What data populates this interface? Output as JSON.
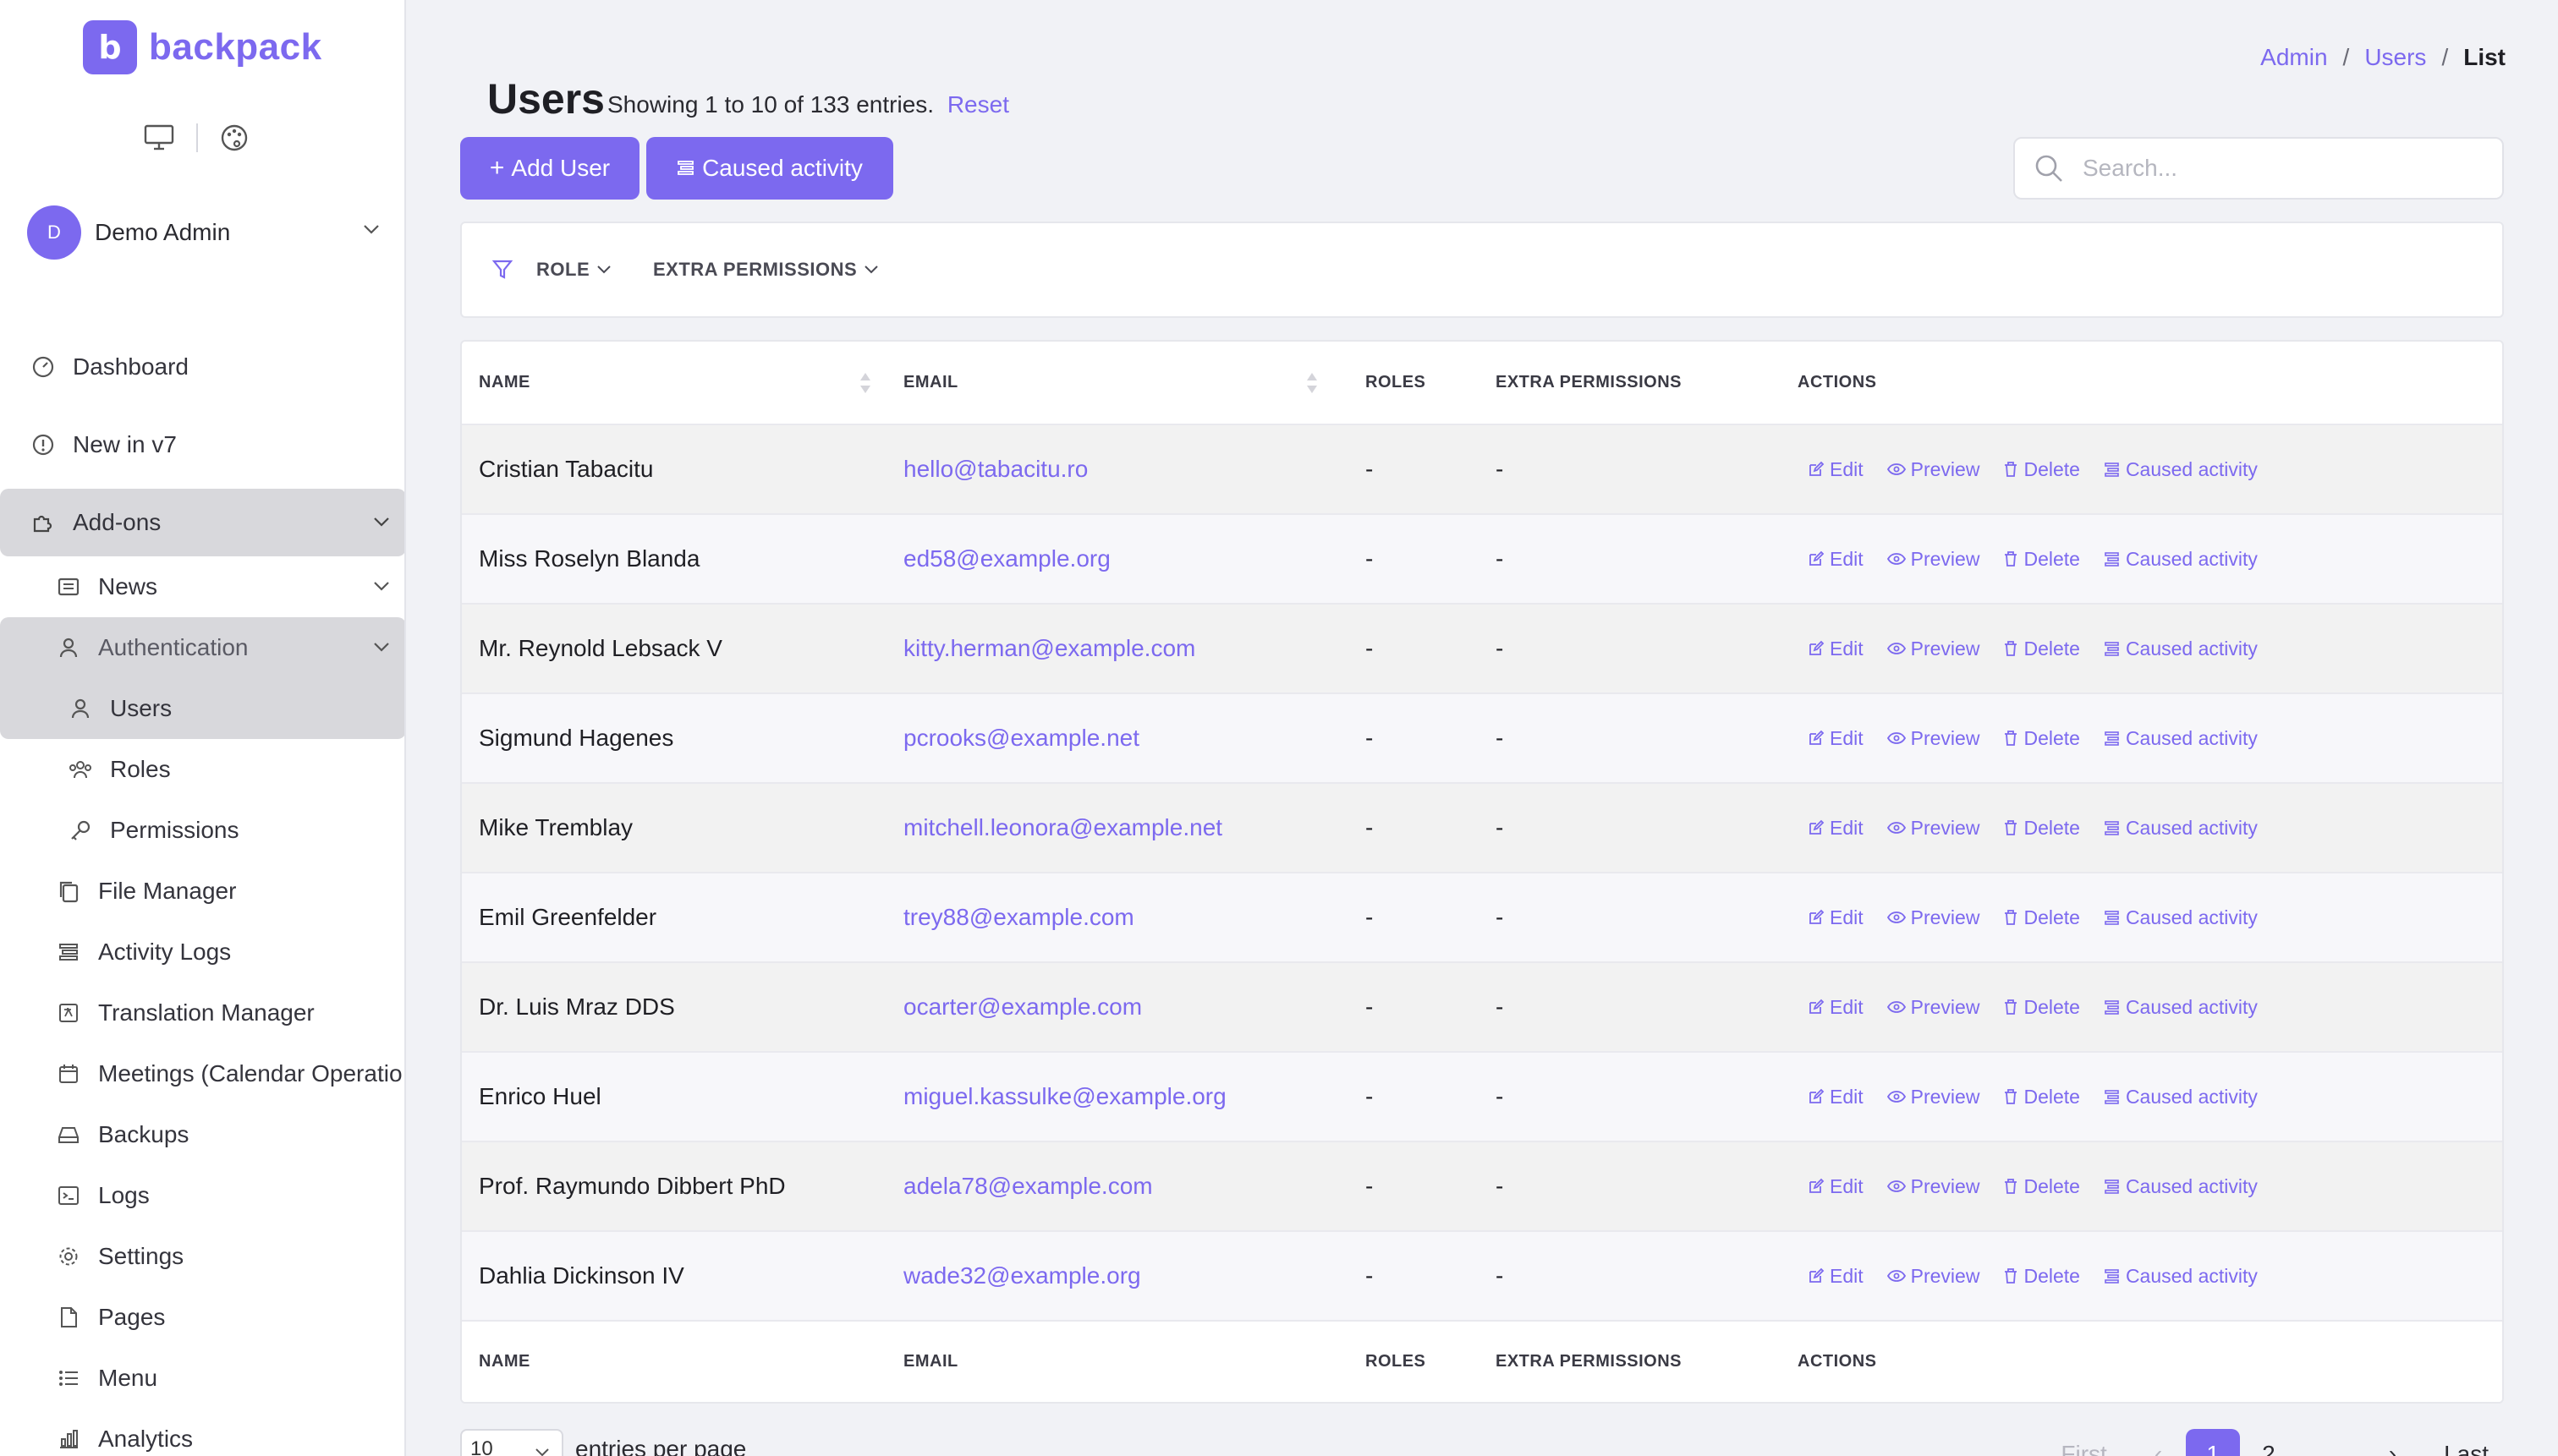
{
  "brand": {
    "logo_letter": "b",
    "name": "backpack"
  },
  "colors": {
    "accent": "#7c69ef",
    "active_bg": "#d8d8dc",
    "page_bg": "#f1f2f6"
  },
  "user": {
    "initial": "D",
    "name": "Demo Admin"
  },
  "sidebar": {
    "dashboard": "Dashboard",
    "new_in_v7": "New in v7",
    "addons": "Add-ons",
    "news": "News",
    "authentication": "Authentication",
    "users": "Users",
    "roles": "Roles",
    "permissions": "Permissions",
    "file_manager": "File Manager",
    "activity_logs": "Activity Logs",
    "translation_manager": "Translation Manager",
    "meetings": "Meetings (Calendar Operatio",
    "backups": "Backups",
    "logs": "Logs",
    "settings": "Settings",
    "pages": "Pages",
    "menu": "Menu",
    "analytics": "Analytics"
  },
  "breadcrumb": {
    "admin": "Admin",
    "sep1": "/",
    "users": "Users",
    "sep2": "/",
    "current": "List"
  },
  "header": {
    "title": "Users",
    "subtitle": "Showing 1 to 10 of 133 entries.",
    "reset": "Reset",
    "add_user": "Add User",
    "caused_activity": "Caused activity"
  },
  "search": {
    "placeholder": "Search..."
  },
  "filters": {
    "role": "ROLE",
    "extra_permissions": "EXTRA PERMISSIONS"
  },
  "table": {
    "columns": [
      "NAME",
      "EMAIL",
      "ROLES",
      "EXTRA PERMISSIONS",
      "ACTIONS"
    ],
    "action_labels": {
      "edit": "Edit",
      "preview": "Preview",
      "delete": "Delete",
      "caused_activity": "Caused activity"
    },
    "rows": [
      {
        "name": "Cristian Tabacitu",
        "email": "hello@tabacitu.ro",
        "roles": "-",
        "extra": "-"
      },
      {
        "name": "Miss Roselyn Blanda",
        "email": "ed58@example.org",
        "roles": "-",
        "extra": "-"
      },
      {
        "name": "Mr. Reynold Lebsack V",
        "email": "kitty.herman@example.com",
        "roles": "-",
        "extra": "-"
      },
      {
        "name": "Sigmund Hagenes",
        "email": "pcrooks@example.net",
        "roles": "-",
        "extra": "-"
      },
      {
        "name": "Mike Tremblay",
        "email": "mitchell.leonora@example.net",
        "roles": "-",
        "extra": "-"
      },
      {
        "name": "Emil Greenfelder",
        "email": "trey88@example.com",
        "roles": "-",
        "extra": "-"
      },
      {
        "name": "Dr. Luis Mraz DDS",
        "email": "ocarter@example.com",
        "roles": "-",
        "extra": "-"
      },
      {
        "name": "Enrico Huel",
        "email": "miguel.kassulke@example.org",
        "roles": "-",
        "extra": "-"
      },
      {
        "name": "Prof. Raymundo Dibbert PhD",
        "email": "adela78@example.com",
        "roles": "-",
        "extra": "-"
      },
      {
        "name": "Dahlia Dickinson IV",
        "email": "wade32@example.org",
        "roles": "-",
        "extra": "-"
      }
    ]
  },
  "footer": {
    "per_page_value": "10",
    "per_page_label": "entries per page",
    "pager": {
      "first": "First",
      "prev": "‹",
      "page1": "1",
      "page2": "2",
      "next": "›",
      "last": "Last"
    }
  }
}
